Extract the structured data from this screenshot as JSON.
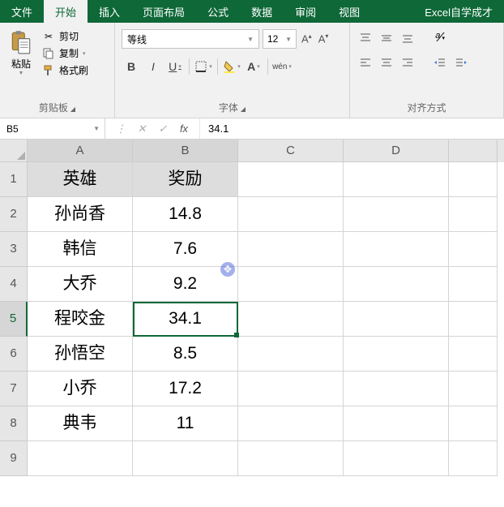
{
  "tabs": {
    "file": "文件",
    "home": "开始",
    "insert": "插入",
    "layout": "页面布局",
    "formulas": "公式",
    "data": "数据",
    "review": "审阅",
    "view": "视图",
    "help": "Excel自学成才"
  },
  "ribbon": {
    "clipboard": {
      "paste": "粘贴",
      "cut": "剪切",
      "copy": "复制",
      "format_painter": "格式刷",
      "group_label": "剪贴板"
    },
    "font": {
      "name": "等线",
      "size": "12",
      "group_label": "字体",
      "bold": "B",
      "italic": "I",
      "underline": "U",
      "wen": "wén"
    },
    "align": {
      "group_label": "对齐方式"
    }
  },
  "formula_bar": {
    "name_box": "B5",
    "fx": "fx",
    "value": "34.1"
  },
  "columns": [
    "A",
    "B",
    "C",
    "D",
    ""
  ],
  "row_numbers": [
    "1",
    "2",
    "3",
    "4",
    "5",
    "6",
    "7",
    "8",
    "9"
  ],
  "selected_row": 5,
  "chart_data": {
    "type": "table",
    "headers": [
      "英雄",
      "奖励"
    ],
    "rows": [
      [
        "孙尚香",
        "14.8"
      ],
      [
        "韩信",
        "7.6"
      ],
      [
        "大乔",
        "9.2"
      ],
      [
        "程咬金",
        "34.1"
      ],
      [
        "孙悟空",
        "8.5"
      ],
      [
        "小乔",
        "17.2"
      ],
      [
        "典韦",
        "11"
      ]
    ]
  }
}
